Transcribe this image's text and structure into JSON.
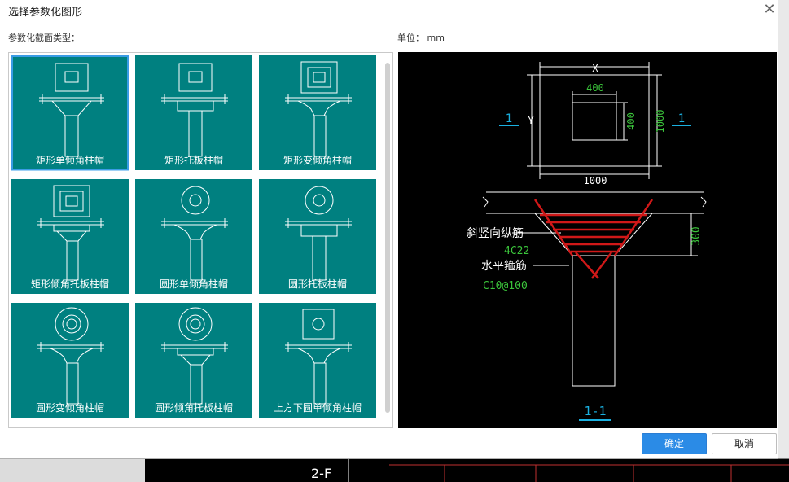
{
  "dialog": {
    "title": "选择参数化图形",
    "section_label": "参数化截面类型：",
    "unit_label": "单位：",
    "unit_value": "mm",
    "ok_label": "确定",
    "cancel_label": "取消"
  },
  "tiles": [
    {
      "label": "矩形单倾角柱帽",
      "selected": true
    },
    {
      "label": "矩形托板柱帽",
      "selected": false
    },
    {
      "label": "矩形变倾角柱帽",
      "selected": false
    },
    {
      "label": "矩形倾角托板柱帽",
      "selected": false
    },
    {
      "label": "圆形单倾角柱帽",
      "selected": false
    },
    {
      "label": "圆形托板柱帽",
      "selected": false
    },
    {
      "label": "圆形变倾角柱帽",
      "selected": false
    },
    {
      "label": "圆形倾角托板柱帽",
      "selected": false
    },
    {
      "label": "上方下圆单倾角柱帽",
      "selected": false
    }
  ],
  "preview": {
    "dim_x": "X",
    "dim_y": "Y",
    "dim_400_top": "400",
    "dim_400_side": "400",
    "dim_1000_right": "1000",
    "dim_1000_bottom": "1000",
    "section_mark_left": "1",
    "section_mark_right": "1",
    "dim_300": "300",
    "label_rebar_slant": "斜竖向纵筋",
    "rebar_slant_value": "4C22",
    "label_rebar_hoop": "水平箍筋",
    "rebar_hoop_value": "C10@100",
    "section_title": "1-1"
  },
  "background": {
    "cad_text": "2-F"
  }
}
